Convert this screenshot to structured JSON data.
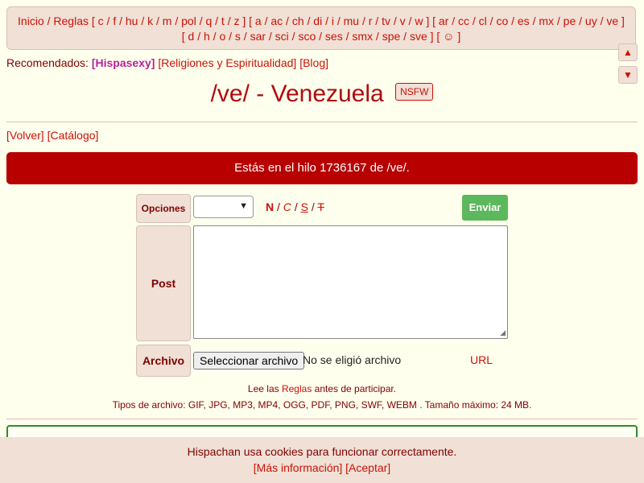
{
  "topnav": {
    "line1": "Inicio / Reglas [ c / f / hu / k / m / pol / q / t / z ] [ a / ac / ch / di / i / mu / r / tv / v / w ] [ ar / cc / cl / co / es / mx / pe / uy / ve ]",
    "line2": "[ d / h / o / s / sar / sci / sco / ses / smx / spe / sve ] [ ☺ ]"
  },
  "scroll": {
    "up": "▲",
    "down": "▼"
  },
  "recommended": {
    "label": "Recomendados:",
    "hot": "[Hispasexy]",
    "links": [
      "[Religiones y Espiritualidad]",
      "[Blog]"
    ]
  },
  "board": {
    "title": "/ve/ - Venezuela",
    "badge": "NSFW"
  },
  "nav": {
    "back": "[Volver]",
    "catalog": "[Catálogo]"
  },
  "banner": "Estás en el hilo 1736167 de /ve/.",
  "form": {
    "options_label": "Opciones",
    "format": {
      "bold": "N",
      "italic": "C",
      "underline": "S",
      "strike": "T"
    },
    "submit": "Enviar",
    "post_label": "Post",
    "file_label": "Archivo",
    "file_button": "Seleccionar archivo",
    "file_status": "No se eligió archivo",
    "url_link": "URL"
  },
  "rules": {
    "prefix": "Lee las",
    "link": "Reglas",
    "suffix": "antes de participar."
  },
  "filetypes": "Tipos de archivo: GIF, JPG, MP3, MP4, OGG, PDF, PNG, SWF, WEBM . Tamaño máximo: 24 MB.",
  "cookie": {
    "message": "Hispachan usa cookies para funcionar correctamente.",
    "more": "[Más información]",
    "accept": "[Aceptar]"
  }
}
